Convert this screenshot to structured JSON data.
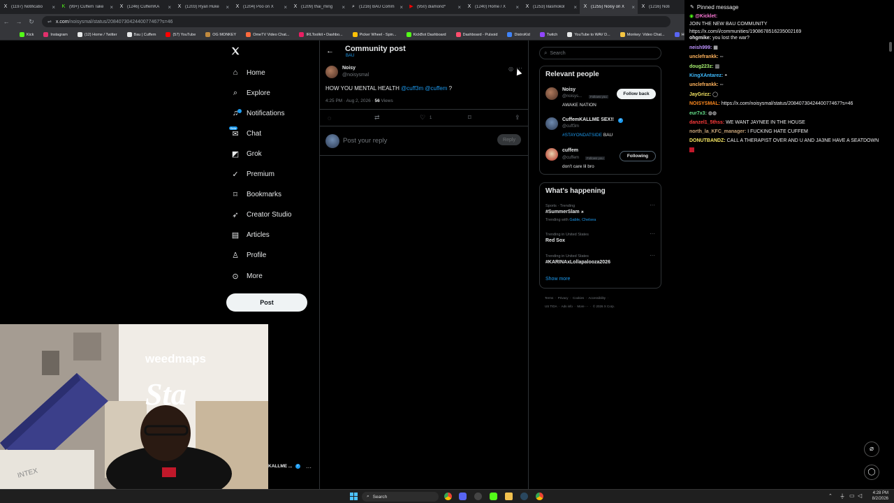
{
  "browser": {
    "tabs": [
      {
        "label": "(1197) Notificatio",
        "icon": "x-icon",
        "active": false
      },
      {
        "label": "(99+) Cuffem Take",
        "icon": "kick-icon",
        "active": false
      },
      {
        "label": "(1246) CuffemKA",
        "icon": "x-icon",
        "active": false
      },
      {
        "label": "(1203) Ryan Huke",
        "icon": "x-icon",
        "active": false
      },
      {
        "label": "(1204) Poo on X",
        "icon": "x-icon",
        "active": false
      },
      {
        "label": "(1209) thai_ming",
        "icon": "x-icon",
        "active": false
      },
      {
        "label": "(1216) BAU Comm",
        "icon": "search-icon",
        "active": false
      },
      {
        "label": "(950) diamond*",
        "icon": "youtube-icon",
        "active": false
      },
      {
        "label": "(1240) Home / X",
        "icon": "x-icon",
        "active": false
      },
      {
        "label": "(1253) lilasmokol",
        "icon": "x-icon",
        "active": false
      },
      {
        "label": "(1255) Noisy on X",
        "icon": "x-icon",
        "active": true
      },
      {
        "label": "(1216) Noti",
        "icon": "x-icon",
        "active": false
      }
    ],
    "url_host": "x.com",
    "url_path": "/noisysmal/status/2084073042440077467?s=46",
    "bookmarks": [
      {
        "label": "Kick",
        "color": "#53fc18"
      },
      {
        "label": "Instagram",
        "color": "#e1306c"
      },
      {
        "label": "(12) Home / Twitter",
        "color": "#e7e9ea"
      },
      {
        "label": "Bau | Cuffem",
        "color": "#e7e9ea"
      },
      {
        "label": "(57) YouTube",
        "color": "#ff0000"
      },
      {
        "label": "OG MONKEY",
        "color": "#c08a3e"
      },
      {
        "label": "OmeTV Video Chat...",
        "color": "#ff6a3d"
      },
      {
        "label": "IRLToolkit • Dashbo...",
        "color": "#e91e63"
      },
      {
        "label": "Picker Wheel - Spin...",
        "color": "#ffc107"
      },
      {
        "label": "KickBot Dashboard",
        "color": "#53fc18"
      },
      {
        "label": "Dashboard - Pulsoid",
        "color": "#ff4d6d"
      },
      {
        "label": "DistroKid",
        "color": "#3f83f8"
      },
      {
        "label": "Twitch",
        "color": "#9146ff"
      },
      {
        "label": "YouTube to WAV D...",
        "color": "#e7e9ea"
      },
      {
        "label": "Monkey: Video Chat...",
        "color": "#f5c542"
      },
      {
        "label": "Home - Rob",
        "color": "#5865f2"
      }
    ]
  },
  "nav": {
    "items": [
      {
        "label": "Home",
        "icon": "home-icon"
      },
      {
        "label": "Explore",
        "icon": "search-icon"
      },
      {
        "label": "Notifications",
        "icon": "bell-icon"
      },
      {
        "label": "Chat",
        "icon": "chat-icon"
      },
      {
        "label": "Grok",
        "icon": "grok-icon"
      },
      {
        "label": "Premium",
        "icon": "premium-icon"
      },
      {
        "label": "Bookmarks",
        "icon": "bookmark-icon"
      },
      {
        "label": "Creator Studio",
        "icon": "rocket-icon"
      },
      {
        "label": "Articles",
        "icon": "article-icon"
      },
      {
        "label": "Profile",
        "icon": "person-icon"
      },
      {
        "label": "More",
        "icon": "more-circle-icon"
      }
    ],
    "post_label": "Post",
    "chat_badge": "Beta"
  },
  "post": {
    "header_title": "Community post",
    "header_subtitle": "BAU",
    "author_name": "Noisy",
    "author_handle": "@noisysmal",
    "text_prefix": "HOW YOU MENTAL HEALTH",
    "mention1": "@cuff3m",
    "mention2": "@cuffem",
    "text_suffix": "?",
    "time": "4:25 PM · Aug 2, 2026 ·",
    "views_count": "56",
    "views_label": "Views",
    "like_count": "1",
    "reply_placeholder": "Post your reply",
    "reply_button": "Reply"
  },
  "sidebar": {
    "search_placeholder": "Search",
    "relevant_title": "Relevant people",
    "people": [
      {
        "name": "Noisy",
        "handle": "@noisys...",
        "follows": "Follows you",
        "bio": "AWAKE NATION",
        "action": "Follow back"
      },
      {
        "name": "CuffemKALLME SEX!!",
        "handle": "@cuff3m",
        "bio_link": "#STAYONDATSIDE",
        "bio_tail": "BAU"
      },
      {
        "name": "cuffem",
        "handle": "@cuffem",
        "follows": "Follows you",
        "bio": "don't care lil bro",
        "action": "Following"
      }
    ],
    "happening_title": "What's happening",
    "trends": [
      {
        "meta": "Sports · Trending",
        "title": "#SummerSlam",
        "extra_prefix": "Trending with",
        "extra_links": "Gable, Chelsea"
      },
      {
        "meta": "Trending in United States",
        "title": "Red Sox"
      },
      {
        "meta": "Trending in United States",
        "title": "#KARINAxLollapalooza2026"
      }
    ],
    "show_more": "Show more",
    "footer_line1": "Terms  ·  Privacy  ·  Cookies  ·  Accessibility  ·",
    "footer_line2": "US TIDA  ·  Ads info  ·  More ···  ·  © 2026 X Corp."
  },
  "chat": {
    "pinned_label": "Pinned message",
    "pinned_user": "@Kicklet:",
    "pinned_line1": "JOIN THE NEW BAU COMMUNITY",
    "pinned_line2": "https://x.com/i/communities/1908678516235002169",
    "messages": [
      {
        "user": "ohgmike:",
        "text": "you lost the war?",
        "color": "#efeff1"
      },
      {
        "user": "neish999:",
        "text": "▦",
        "color": "#bf94ff"
      },
      {
        "user": "unclefrankk:",
        "text": "◦◦",
        "color": "#ffb35c"
      },
      {
        "user": "doug223z:",
        "text": "▥",
        "color": "#a7f070"
      },
      {
        "user": "KingXAntarez:",
        "text": "◓",
        "color": "#3fbcff"
      },
      {
        "user": "unclefrankk:",
        "text": "◦◦",
        "color": "#ffb35c"
      },
      {
        "user": "JayGrizz:",
        "text": "◯",
        "color": "#f5e663"
      },
      {
        "user": "NOISYSMAL:",
        "text": "https://x.com/noisysmal/status/2084073042440077467?s=46",
        "color": "#ff8a1f"
      },
      {
        "user": "eur7x3:",
        "text": "◍◍",
        "color": "#66e08a"
      },
      {
        "user": "danzel1_5thss:",
        "text": "WE WANT JAYNEE IN THE HOUSE",
        "color": "#ff3b3b"
      },
      {
        "user": "north_la_KFC_manager:",
        "text": "I FUCKING HATE CUFFEM",
        "color": "#c9a57a"
      },
      {
        "user": "DONUTBANDZ:",
        "text": "CALL A THERAPIST OVER AND U AND JA3NE HAVE A SEATDOWN",
        "color": "#f5e663"
      }
    ]
  },
  "webcam": {
    "sign_text": "weedmaps",
    "sign_script": "Sta",
    "mattress_brand": "INTEX",
    "overlay_name": "KALLME ..."
  },
  "taskbar": {
    "search_label": "Search",
    "time": "4:28 PM",
    "date": "8/2/2026"
  }
}
